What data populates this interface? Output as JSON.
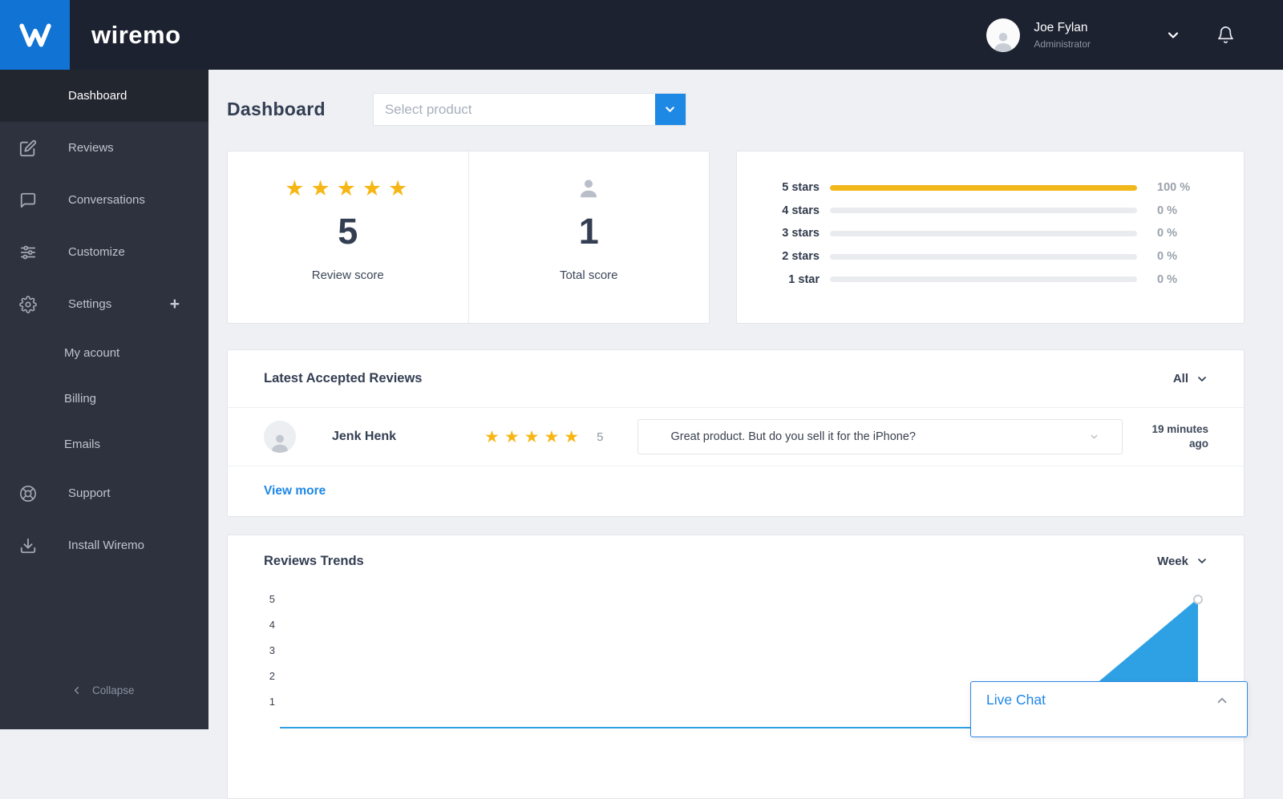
{
  "brand": {
    "name": "wiremo"
  },
  "topbar": {
    "user_name": "Joe Fylan",
    "user_role": "Administrator"
  },
  "sidebar": {
    "items": [
      {
        "label": "Dashboard"
      },
      {
        "label": "Reviews"
      },
      {
        "label": "Conversations"
      },
      {
        "label": "Customize"
      },
      {
        "label": "Settings"
      },
      {
        "label": "My acount"
      },
      {
        "label": "Billing"
      },
      {
        "label": "Emails"
      },
      {
        "label": "Support"
      },
      {
        "label": "Install Wiremo"
      }
    ],
    "settings_plus": "+",
    "collapse_label": "Collapse"
  },
  "page": {
    "title": "Dashboard",
    "select_placeholder": "Select product"
  },
  "score_card": {
    "stars": 5,
    "review_score": "5",
    "review_score_label": "Review score",
    "total_score": "1",
    "total_score_label": "Total score"
  },
  "distribution": {
    "rows": [
      {
        "label": "5 stars",
        "percent": 100,
        "percent_label": "100 %"
      },
      {
        "label": "4 stars",
        "percent": 0,
        "percent_label": "0 %"
      },
      {
        "label": "3 stars",
        "percent": 0,
        "percent_label": "0 %"
      },
      {
        "label": "2 stars",
        "percent": 0,
        "percent_label": "0 %"
      },
      {
        "label": "1 star",
        "percent": 0,
        "percent_label": "0 %"
      }
    ]
  },
  "latest_reviews": {
    "title": "Latest Accepted Reviews",
    "filter": "All",
    "view_more": "View more",
    "review": {
      "name": "Jenk Henk",
      "stars": 5,
      "score": "5",
      "text": "Great product. But do you sell it for the iPhone?",
      "time": "19 minutes ago"
    }
  },
  "trends": {
    "title": "Reviews Trends",
    "filter": "Week"
  },
  "live_chat": {
    "label": "Live Chat"
  },
  "chart_data": {
    "type": "area",
    "title": "Reviews Trends",
    "period": "Week",
    "ylim": [
      0,
      5
    ],
    "y_ticks": [
      5,
      4,
      3,
      2,
      1
    ],
    "values": [
      0,
      0,
      0,
      0,
      0,
      0,
      5
    ],
    "line_color": "#2ea1e4",
    "fill_color": "#2ea1e4",
    "grid": false
  },
  "colors": {
    "accent_blue": "#1e88e5",
    "star_yellow": "#f6b715",
    "bar_yellow": "#f2b718",
    "topbar_bg": "#1d2230",
    "sidebar_bg": "#2d323e"
  }
}
